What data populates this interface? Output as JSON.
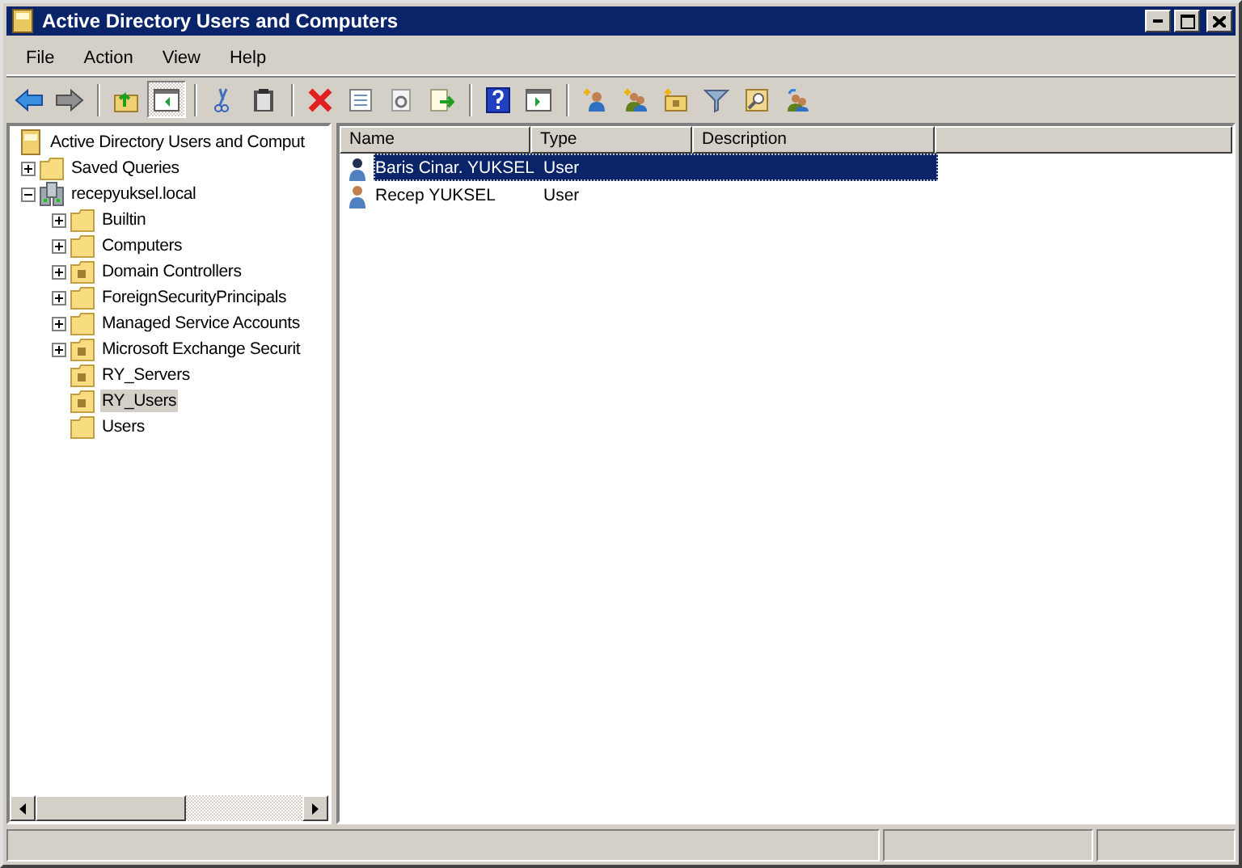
{
  "window": {
    "title": "Active Directory Users and Computers"
  },
  "menu": [
    "File",
    "Action",
    "View",
    "Help"
  ],
  "toolbar": [
    {
      "kind": "back",
      "pressed": false
    },
    {
      "kind": "forward",
      "pressed": false
    },
    {
      "kind": "sep"
    },
    {
      "kind": "up",
      "pressed": false
    },
    {
      "kind": "tree",
      "pressed": true
    },
    {
      "kind": "sep"
    },
    {
      "kind": "cut",
      "pressed": false
    },
    {
      "kind": "paste",
      "pressed": false
    },
    {
      "kind": "sep"
    },
    {
      "kind": "delete",
      "pressed": false
    },
    {
      "kind": "properties",
      "pressed": false
    },
    {
      "kind": "refresh",
      "pressed": false
    },
    {
      "kind": "export",
      "pressed": false
    },
    {
      "kind": "sep"
    },
    {
      "kind": "help",
      "pressed": false
    },
    {
      "kind": "pane",
      "pressed": false
    },
    {
      "kind": "sep"
    },
    {
      "kind": "newuser",
      "pressed": false
    },
    {
      "kind": "newgroup",
      "pressed": false
    },
    {
      "kind": "newou",
      "pressed": false
    },
    {
      "kind": "filter",
      "pressed": false
    },
    {
      "kind": "find",
      "pressed": false
    },
    {
      "kind": "addgroup",
      "pressed": false
    }
  ],
  "tree": [
    {
      "label": "Active Directory Users and Comput",
      "kind": "root",
      "selected": false,
      "children": [
        {
          "label": "Saved Queries",
          "kind": "folder",
          "selected": false,
          "expanded": false
        },
        {
          "label": "recepyuksel.local",
          "kind": "domain",
          "selected": false,
          "expanded": true,
          "children": [
            {
              "label": "Builtin",
              "kind": "folder",
              "selected": false,
              "expanded": false
            },
            {
              "label": "Computers",
              "kind": "folder",
              "selected": false,
              "expanded": false
            },
            {
              "label": "Domain Controllers",
              "kind": "ou",
              "selected": false,
              "expanded": false
            },
            {
              "label": "ForeignSecurityPrincipals",
              "kind": "folder",
              "selected": false,
              "expanded": false
            },
            {
              "label": "Managed Service Accounts",
              "kind": "folder",
              "selected": false,
              "expanded": false
            },
            {
              "label": "Microsoft Exchange Securit",
              "kind": "ou",
              "selected": false,
              "expanded": false
            },
            {
              "label": "RY_Servers",
              "kind": "ou",
              "selected": false
            },
            {
              "label": "RY_Users",
              "kind": "ou",
              "selected": true
            },
            {
              "label": "Users",
              "kind": "folder",
              "selected": false
            }
          ]
        }
      ]
    }
  ],
  "list": {
    "columns": [
      "Name",
      "Type",
      "Description"
    ],
    "rows": [
      {
        "name": "Baris Cinar. YUKSEL",
        "type": "User",
        "selected": true
      },
      {
        "name": "Recep YUKSEL",
        "type": "User",
        "selected": false
      }
    ]
  }
}
